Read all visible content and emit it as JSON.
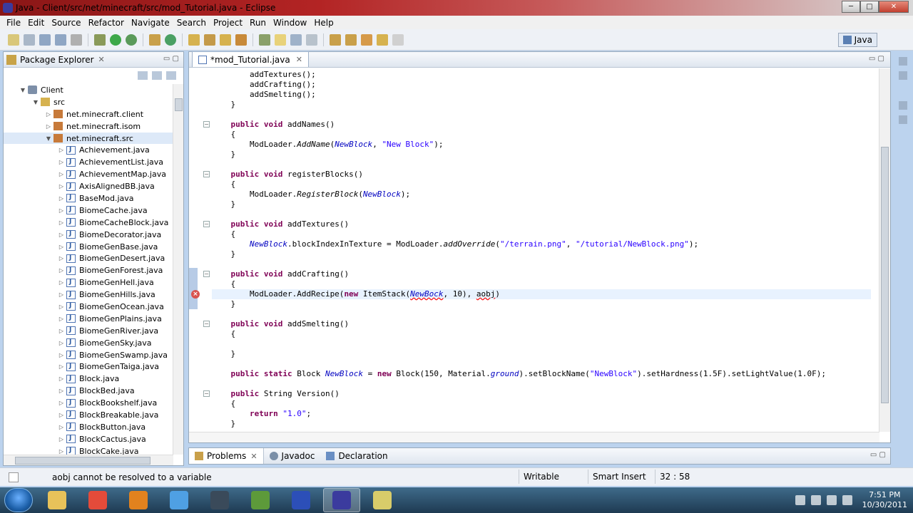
{
  "window": {
    "title": "Java - Client/src/net/minecraft/src/mod_Tutorial.java - Eclipse",
    "buttons": {
      "minimize": "─",
      "maximize": "□",
      "close": "✕"
    }
  },
  "menu": [
    "File",
    "Edit",
    "Source",
    "Refactor",
    "Navigate",
    "Search",
    "Project",
    "Run",
    "Window",
    "Help"
  ],
  "perspective": {
    "label": "Java"
  },
  "package_explorer": {
    "title": "Package Explorer",
    "tree": [
      {
        "label": "Client",
        "kind": "project",
        "indent": 0,
        "arrow": "▼"
      },
      {
        "label": "src",
        "kind": "folder",
        "indent": 1,
        "arrow": "▼"
      },
      {
        "label": "net.minecraft.client",
        "kind": "package",
        "indent": 2,
        "arrow": "▷"
      },
      {
        "label": "net.minecraft.isom",
        "kind": "package",
        "indent": 2,
        "arrow": "▷"
      },
      {
        "label": "net.minecraft.src",
        "kind": "package",
        "indent": 2,
        "arrow": "▼",
        "selected": true
      },
      {
        "label": "Achievement.java",
        "kind": "java",
        "indent": 3,
        "arrow": "▷"
      },
      {
        "label": "AchievementList.java",
        "kind": "java",
        "indent": 3,
        "arrow": "▷"
      },
      {
        "label": "AchievementMap.java",
        "kind": "java",
        "indent": 3,
        "arrow": "▷"
      },
      {
        "label": "AxisAlignedBB.java",
        "kind": "java",
        "indent": 3,
        "arrow": "▷"
      },
      {
        "label": "BaseMod.java",
        "kind": "java",
        "indent": 3,
        "arrow": "▷"
      },
      {
        "label": "BiomeCache.java",
        "kind": "java",
        "indent": 3,
        "arrow": "▷"
      },
      {
        "label": "BiomeCacheBlock.java",
        "kind": "java",
        "indent": 3,
        "arrow": "▷"
      },
      {
        "label": "BiomeDecorator.java",
        "kind": "java",
        "indent": 3,
        "arrow": "▷"
      },
      {
        "label": "BiomeGenBase.java",
        "kind": "java",
        "indent": 3,
        "arrow": "▷"
      },
      {
        "label": "BiomeGenDesert.java",
        "kind": "java",
        "indent": 3,
        "arrow": "▷"
      },
      {
        "label": "BiomeGenForest.java",
        "kind": "java",
        "indent": 3,
        "arrow": "▷"
      },
      {
        "label": "BiomeGenHell.java",
        "kind": "java",
        "indent": 3,
        "arrow": "▷"
      },
      {
        "label": "BiomeGenHills.java",
        "kind": "java",
        "indent": 3,
        "arrow": "▷"
      },
      {
        "label": "BiomeGenOcean.java",
        "kind": "java",
        "indent": 3,
        "arrow": "▷"
      },
      {
        "label": "BiomeGenPlains.java",
        "kind": "java",
        "indent": 3,
        "arrow": "▷"
      },
      {
        "label": "BiomeGenRiver.java",
        "kind": "java",
        "indent": 3,
        "arrow": "▷"
      },
      {
        "label": "BiomeGenSky.java",
        "kind": "java",
        "indent": 3,
        "arrow": "▷"
      },
      {
        "label": "BiomeGenSwamp.java",
        "kind": "java",
        "indent": 3,
        "arrow": "▷"
      },
      {
        "label": "BiomeGenTaiga.java",
        "kind": "java",
        "indent": 3,
        "arrow": "▷"
      },
      {
        "label": "Block.java",
        "kind": "java",
        "indent": 3,
        "arrow": "▷"
      },
      {
        "label": "BlockBed.java",
        "kind": "java",
        "indent": 3,
        "arrow": "▷"
      },
      {
        "label": "BlockBookshelf.java",
        "kind": "java",
        "indent": 3,
        "arrow": "▷"
      },
      {
        "label": "BlockBreakable.java",
        "kind": "java",
        "indent": 3,
        "arrow": "▷"
      },
      {
        "label": "BlockButton.java",
        "kind": "java",
        "indent": 3,
        "arrow": "▷"
      },
      {
        "label": "BlockCactus.java",
        "kind": "java",
        "indent": 3,
        "arrow": "▷"
      },
      {
        "label": "BlockCake.java",
        "kind": "java",
        "indent": 3,
        "arrow": "▷"
      }
    ]
  },
  "editor": {
    "tab_label": "*mod_Tutorial.java",
    "lines": [
      {
        "t": "        addTextures();"
      },
      {
        "t": "        addCrafting();"
      },
      {
        "t": "        addSmelting();"
      },
      {
        "t": "    }"
      },
      {
        "t": ""
      },
      {
        "t": "    public void addNames()",
        "fold": true
      },
      {
        "t": "    {"
      },
      {
        "t": "        ModLoader.AddName(NewBlock, \"New Block\");"
      },
      {
        "t": "    }"
      },
      {
        "t": ""
      },
      {
        "t": "    public void registerBlocks()",
        "fold": true
      },
      {
        "t": "    {"
      },
      {
        "t": "        ModLoader.RegisterBlock(NewBlock);"
      },
      {
        "t": "    }"
      },
      {
        "t": ""
      },
      {
        "t": "    public void addTextures()",
        "fold": true
      },
      {
        "t": "    {"
      },
      {
        "t": "        NewBlock.blockIndexInTexture = ModLoader.addOverride(\"/terrain.png\", \"/tutorial/NewBlock.png\");"
      },
      {
        "t": "    }"
      },
      {
        "t": ""
      },
      {
        "t": "    public void addCrafting()",
        "fold": true
      },
      {
        "t": "    {"
      },
      {
        "t": "        ModLoader.AddRecipe(new ItemStack(NewBock, 10), aobj)",
        "highlight": true,
        "error": true
      },
      {
        "t": "    }"
      },
      {
        "t": ""
      },
      {
        "t": "    public void addSmelting()",
        "fold": true
      },
      {
        "t": "    {"
      },
      {
        "t": ""
      },
      {
        "t": "    }"
      },
      {
        "t": ""
      },
      {
        "t": "    public static Block NewBlock = new Block(150, Material.ground).setBlockName(\"NewBlock\").setHardness(1.5F).setLightValue(1.0F);"
      },
      {
        "t": ""
      },
      {
        "t": "    public String Version()",
        "fold": true
      },
      {
        "t": "    {"
      },
      {
        "t": "        return \"1.0\";"
      },
      {
        "t": "    }"
      }
    ]
  },
  "bottom_tabs": [
    "Problems",
    "Javadoc",
    "Declaration"
  ],
  "status": {
    "message": "aobj cannot be resolved to a variable",
    "writable": "Writable",
    "insert_mode": "Smart Insert",
    "position": "32 : 58"
  },
  "taskbar": {
    "apps": [
      {
        "name": "folder-app-icon",
        "color": "#e8c25a"
      },
      {
        "name": "chrome-app-icon",
        "color": "#e44b3a"
      },
      {
        "name": "firefox-app-icon",
        "color": "#e2821e"
      },
      {
        "name": "safari-app-icon",
        "color": "#4fa0e3"
      },
      {
        "name": "steam-app-icon",
        "color": "#3a4a5a"
      },
      {
        "name": "minecraft-app-icon",
        "color": "#5d9a3a"
      },
      {
        "name": "blue-sphere-app-icon",
        "color": "#2c4fb8"
      },
      {
        "name": "eclipse-app-icon",
        "color": "#3b3b9e",
        "active": true
      },
      {
        "name": "notes-app-icon",
        "color": "#d8cc6a"
      }
    ],
    "time": "7:51 PM",
    "date": "10/30/2011"
  }
}
